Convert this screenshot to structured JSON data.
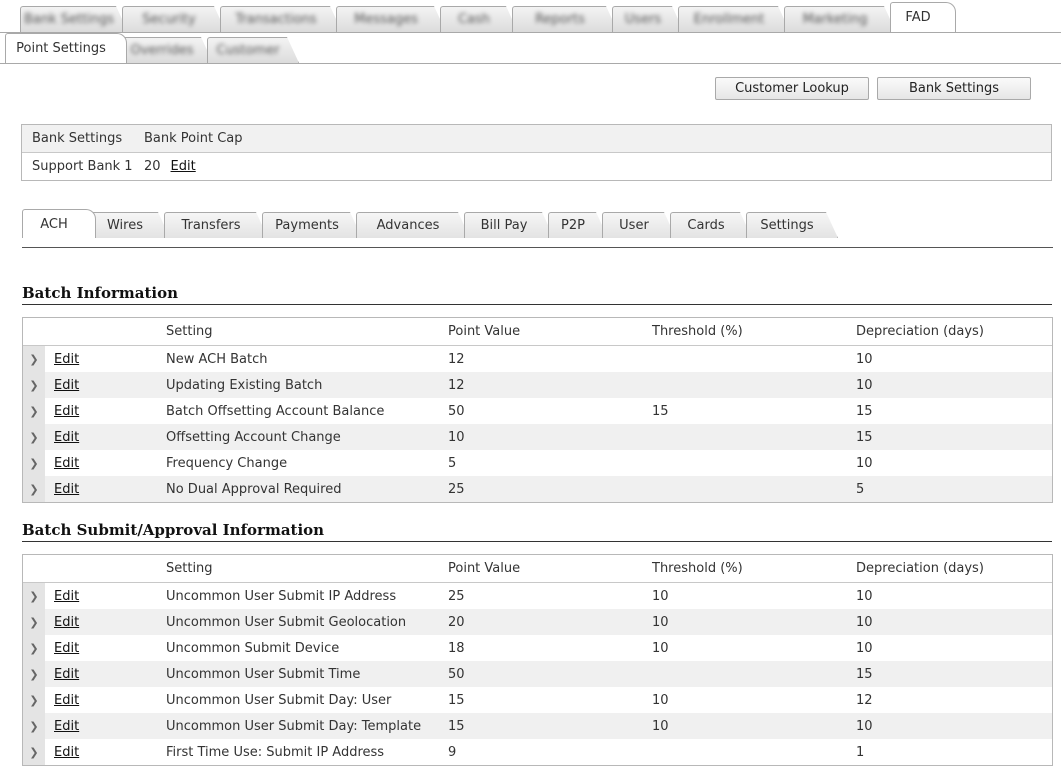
{
  "top_tabs": [
    {
      "label": "Bank Settings",
      "blurred": true
    },
    {
      "label": "Security",
      "blurred": true
    },
    {
      "label": "Transactions",
      "blurred": true
    },
    {
      "label": "Messages",
      "blurred": true
    },
    {
      "label": "Cash",
      "blurred": true
    },
    {
      "label": "Reports",
      "blurred": true
    },
    {
      "label": "Users",
      "blurred": true
    },
    {
      "label": "Enrollment",
      "blurred": true
    },
    {
      "label": "Marketing",
      "blurred": true
    },
    {
      "label": "FAD",
      "blurred": false,
      "active": true
    }
  ],
  "sub_tabs": [
    {
      "label": "Point Settings",
      "active": true
    },
    {
      "label": "Overrides",
      "blurred": true
    },
    {
      "label": "Customer",
      "blurred": true
    }
  ],
  "buttons": {
    "customer_lookup": "Customer Lookup",
    "bank_settings": "Bank Settings"
  },
  "bank_table": {
    "headers": [
      "Bank Settings",
      "Bank Point Cap"
    ],
    "row": {
      "bank": "Support Bank 1",
      "cap": "20",
      "edit": "Edit"
    }
  },
  "category_tabs": [
    "ACH",
    "Wires",
    "Transfers",
    "Payments",
    "Advances",
    "Bill Pay",
    "P2P",
    "User",
    "Cards",
    "Settings"
  ],
  "active_category": "ACH",
  "columns": {
    "setting": "Setting",
    "point_value": "Point Value",
    "threshold": "Threshold (%)",
    "depreciation": "Depreciation (days)"
  },
  "edit_label": "Edit",
  "batch_info": {
    "title": "Batch Information",
    "rows": [
      {
        "setting": "New ACH Batch",
        "point": "12",
        "threshold": "",
        "dep": "10"
      },
      {
        "setting": "Updating Existing Batch",
        "point": "12",
        "threshold": "",
        "dep": "10"
      },
      {
        "setting": "Batch Offsetting Account Balance",
        "point": "50",
        "threshold": "15",
        "dep": "15"
      },
      {
        "setting": "Offsetting Account Change",
        "point": "10",
        "threshold": "",
        "dep": "15"
      },
      {
        "setting": "Frequency Change",
        "point": "5",
        "threshold": "",
        "dep": "10"
      },
      {
        "setting": "No Dual Approval Required",
        "point": "25",
        "threshold": "",
        "dep": "5"
      }
    ]
  },
  "batch_submit": {
    "title": "Batch Submit/Approval Information",
    "rows": [
      {
        "setting": "Uncommon User Submit IP Address",
        "point": "25",
        "threshold": "10",
        "dep": "10"
      },
      {
        "setting": "Uncommon User Submit Geolocation",
        "point": "20",
        "threshold": "10",
        "dep": "10"
      },
      {
        "setting": "Uncommon Submit Device",
        "point": "18",
        "threshold": "10",
        "dep": "10"
      },
      {
        "setting": "Uncommon User Submit Time",
        "point": "50",
        "threshold": "",
        "dep": "15"
      },
      {
        "setting": "Uncommon User Submit Day: User",
        "point": "15",
        "threshold": "10",
        "dep": "12"
      },
      {
        "setting": "Uncommon User Submit Day: Template",
        "point": "15",
        "threshold": "10",
        "dep": "10"
      },
      {
        "setting": "First Time Use: Submit IP Address",
        "point": "9",
        "threshold": "",
        "dep": "1"
      }
    ]
  }
}
